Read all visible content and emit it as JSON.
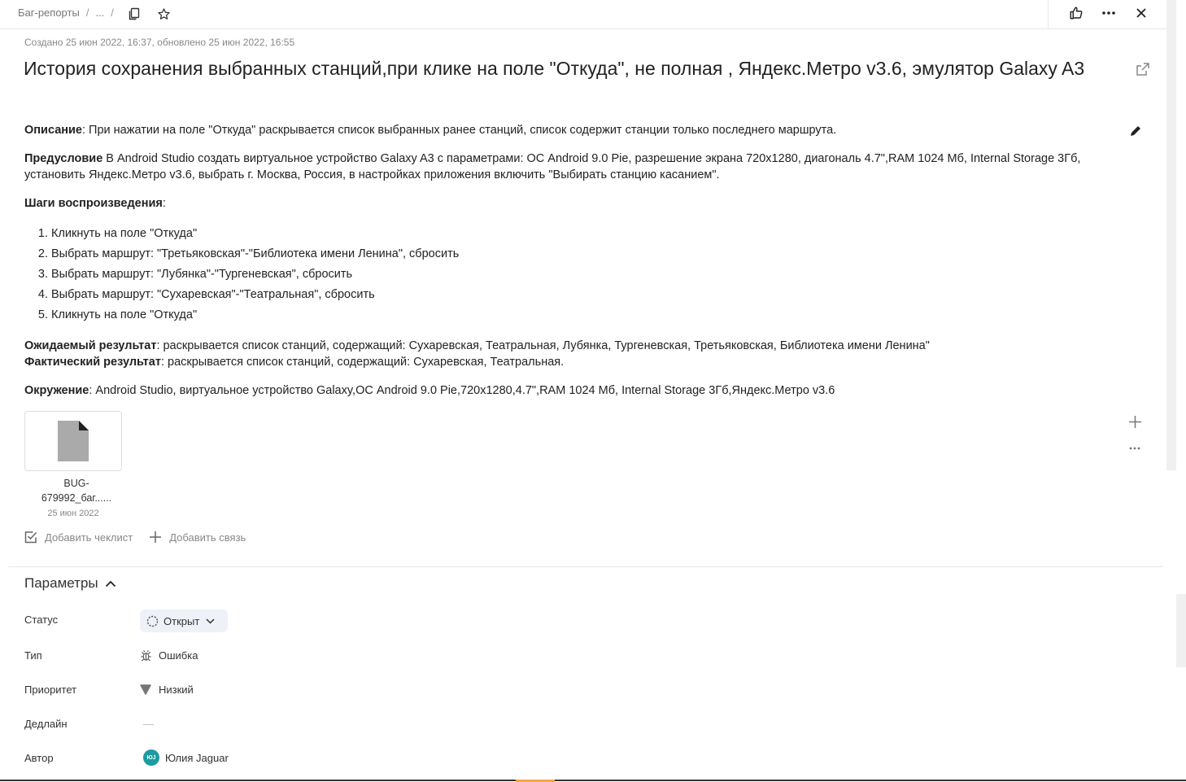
{
  "breadcrumb": {
    "queue": "Баг-репорты",
    "ellipsis": "...",
    "separator": "/"
  },
  "meta": "Создано 25 июн 2022, 16:37, обновлено 25 июн 2022, 16:55",
  "title": "История сохранения выбранных станций,при клике на поле \"Откуда\", не полная , Яндекс.Метро v3.6, эмулятор Galaxy A3",
  "description": {
    "desc_label": "Описание",
    "desc_text": ": При нажатии на поле \"Откуда\" раскрывается список выбранных ранее станций, список содержит станции только последнего маршрута.",
    "pre_label": "Предусловие",
    "pre_text": " В Android Studio создать виртуальное устройство Galaxy A3 с параметрами: ОС Android 9.0 Pie, разрешение экрана 720x1280, диагональ 4.7\",RAM 1024 Мб, Internal Storage 3Гб, установить Яндекс.Метро v3.6, выбрать г. Москва, Россия, в настройках приложения включить \"Выбирать станцию касанием\".",
    "steps_label": "Шаги воспроизведения",
    "steps_colon": ":",
    "steps": [
      "Кликнуть на поле \"Откуда\"",
      "Выбрать маршрут: \"Третьяковская\"-\"Библиотека имени Ленина\", сбросить",
      "Выбрать маршрут: \"Лубянка\"-\"Тургеневская\", сбросить",
      "Выбрать маршрут: \"Сухаревская\"-\"Театральная\", сбросить",
      "Кликнуть на поле \"Откуда\""
    ],
    "expected_label": "Ожидаемый результат",
    "expected_text": ": раскрывается список станций, содержащий: Сухаревская, Театральная, Лубянка, Тургеневская, Третьяковская, Библиотека имени Ленина\"",
    "actual_label": "Фактический результат",
    "actual_text": ": раскрывается список станций, содержащий: Сухаревская, Театральная.",
    "env_label": "Окружение",
    "env_text": ": Android Studio, виртуальное устройство Galaxy,ОС Android 9.0 Pie,720x1280,4.7\",RAM 1024 Мб, Internal Storage 3Гб,Яндекс.Метро v3.6"
  },
  "attachment": {
    "name_line1": "BUG-",
    "name_line2": "679992_баг......",
    "date": "25 июн 2022"
  },
  "actions": {
    "checklist": "Добавить чеклист",
    "link": "Добавить связь"
  },
  "params": {
    "heading": "Параметры",
    "rows": [
      {
        "label": "Статус",
        "value": "Открыт"
      },
      {
        "label": "Тип",
        "value": "Ошибка"
      },
      {
        "label": "Приоритет",
        "value": "Низкий"
      },
      {
        "label": "Дедлайн",
        "value": "—"
      },
      {
        "label": "Автор",
        "value": "Юлия Jaguar",
        "avatar": "ЮJ"
      }
    ]
  },
  "colors": {
    "avatar": "#1e9aa0",
    "status_bg": "#eef1f7",
    "accent": "#f0a848"
  },
  "icons": [
    "copy-icon",
    "star-icon",
    "like-icon",
    "more-icon",
    "close-icon",
    "external-link-icon",
    "pencil-icon",
    "file-icon",
    "plus-icon",
    "dots-icon",
    "checklist-icon",
    "chevron-up-icon",
    "status-open-icon",
    "chevron-down-icon",
    "bug-icon",
    "priority-low-icon"
  ]
}
